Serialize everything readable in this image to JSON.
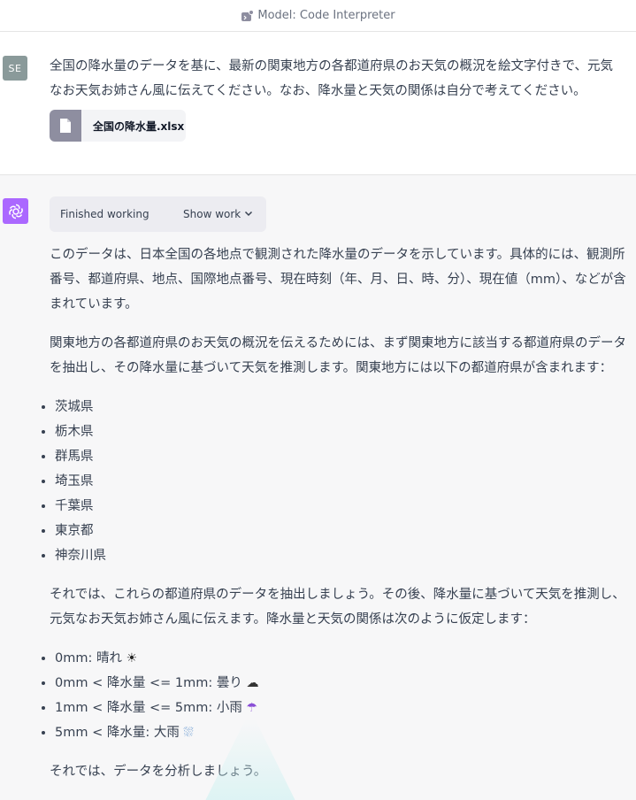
{
  "header": {
    "model_label": "Model: Code Interpreter",
    "plugin_icon": "code-interpreter-icon"
  },
  "user_message": {
    "avatar_initials": "SE",
    "text": "全国の降水量のデータを基に、最新の関東地方の各都道府県のお天気の概況を絵文字付きで、元気なお天気お姉さん風に伝えてください。なお、降水量と天気の関係は自分で考えてください。",
    "attachment": {
      "icon": "file-icon",
      "name": "全国の降水量.xlsx"
    }
  },
  "assistant_message": {
    "avatar_icon": "openai-logo-icon",
    "work_status": "Finished working",
    "show_work_label": "Show work",
    "paragraph1": "このデータは、日本全国の各地点で観測された降水量のデータを示しています。具体的には、観測所番号、都道府県、地点、国際地点番号、現在時刻（年、月、日、時、分）、現在値（mm）、などが含まれています。",
    "paragraph2": "関東地方の各都道府県のお天気の概況を伝えるためには、まず関東地方に該当する都道府県のデータを抽出し、その降水量に基づいて天気を推測します。関東地方には以下の都道府県が含まれます：",
    "prefectures": [
      "茨城県",
      "栃木県",
      "群馬県",
      "埼玉県",
      "千葉県",
      "東京都",
      "神奈川県"
    ],
    "paragraph3": "それでは、これらの都道府県のデータを抽出しましょう。その後、降水量に基づいて天気を推測し、元気なお天気お姉さん風に伝えます。降水量と天気の関係は次のように仮定します：",
    "rules": [
      {
        "text": "0mm: 晴れ ",
        "emoji": "☀"
      },
      {
        "text": "0mm < 降水量 <= 1mm: 曇り ",
        "emoji": "☁"
      },
      {
        "text": "1mm < 降水量 <= 5mm: 小雨 ",
        "emoji": "☂"
      },
      {
        "text": "5mm < 降水量: 大雨 ",
        "emoji": "⛆"
      }
    ],
    "paragraph4": "それでは、データを分析しましょう。"
  }
}
